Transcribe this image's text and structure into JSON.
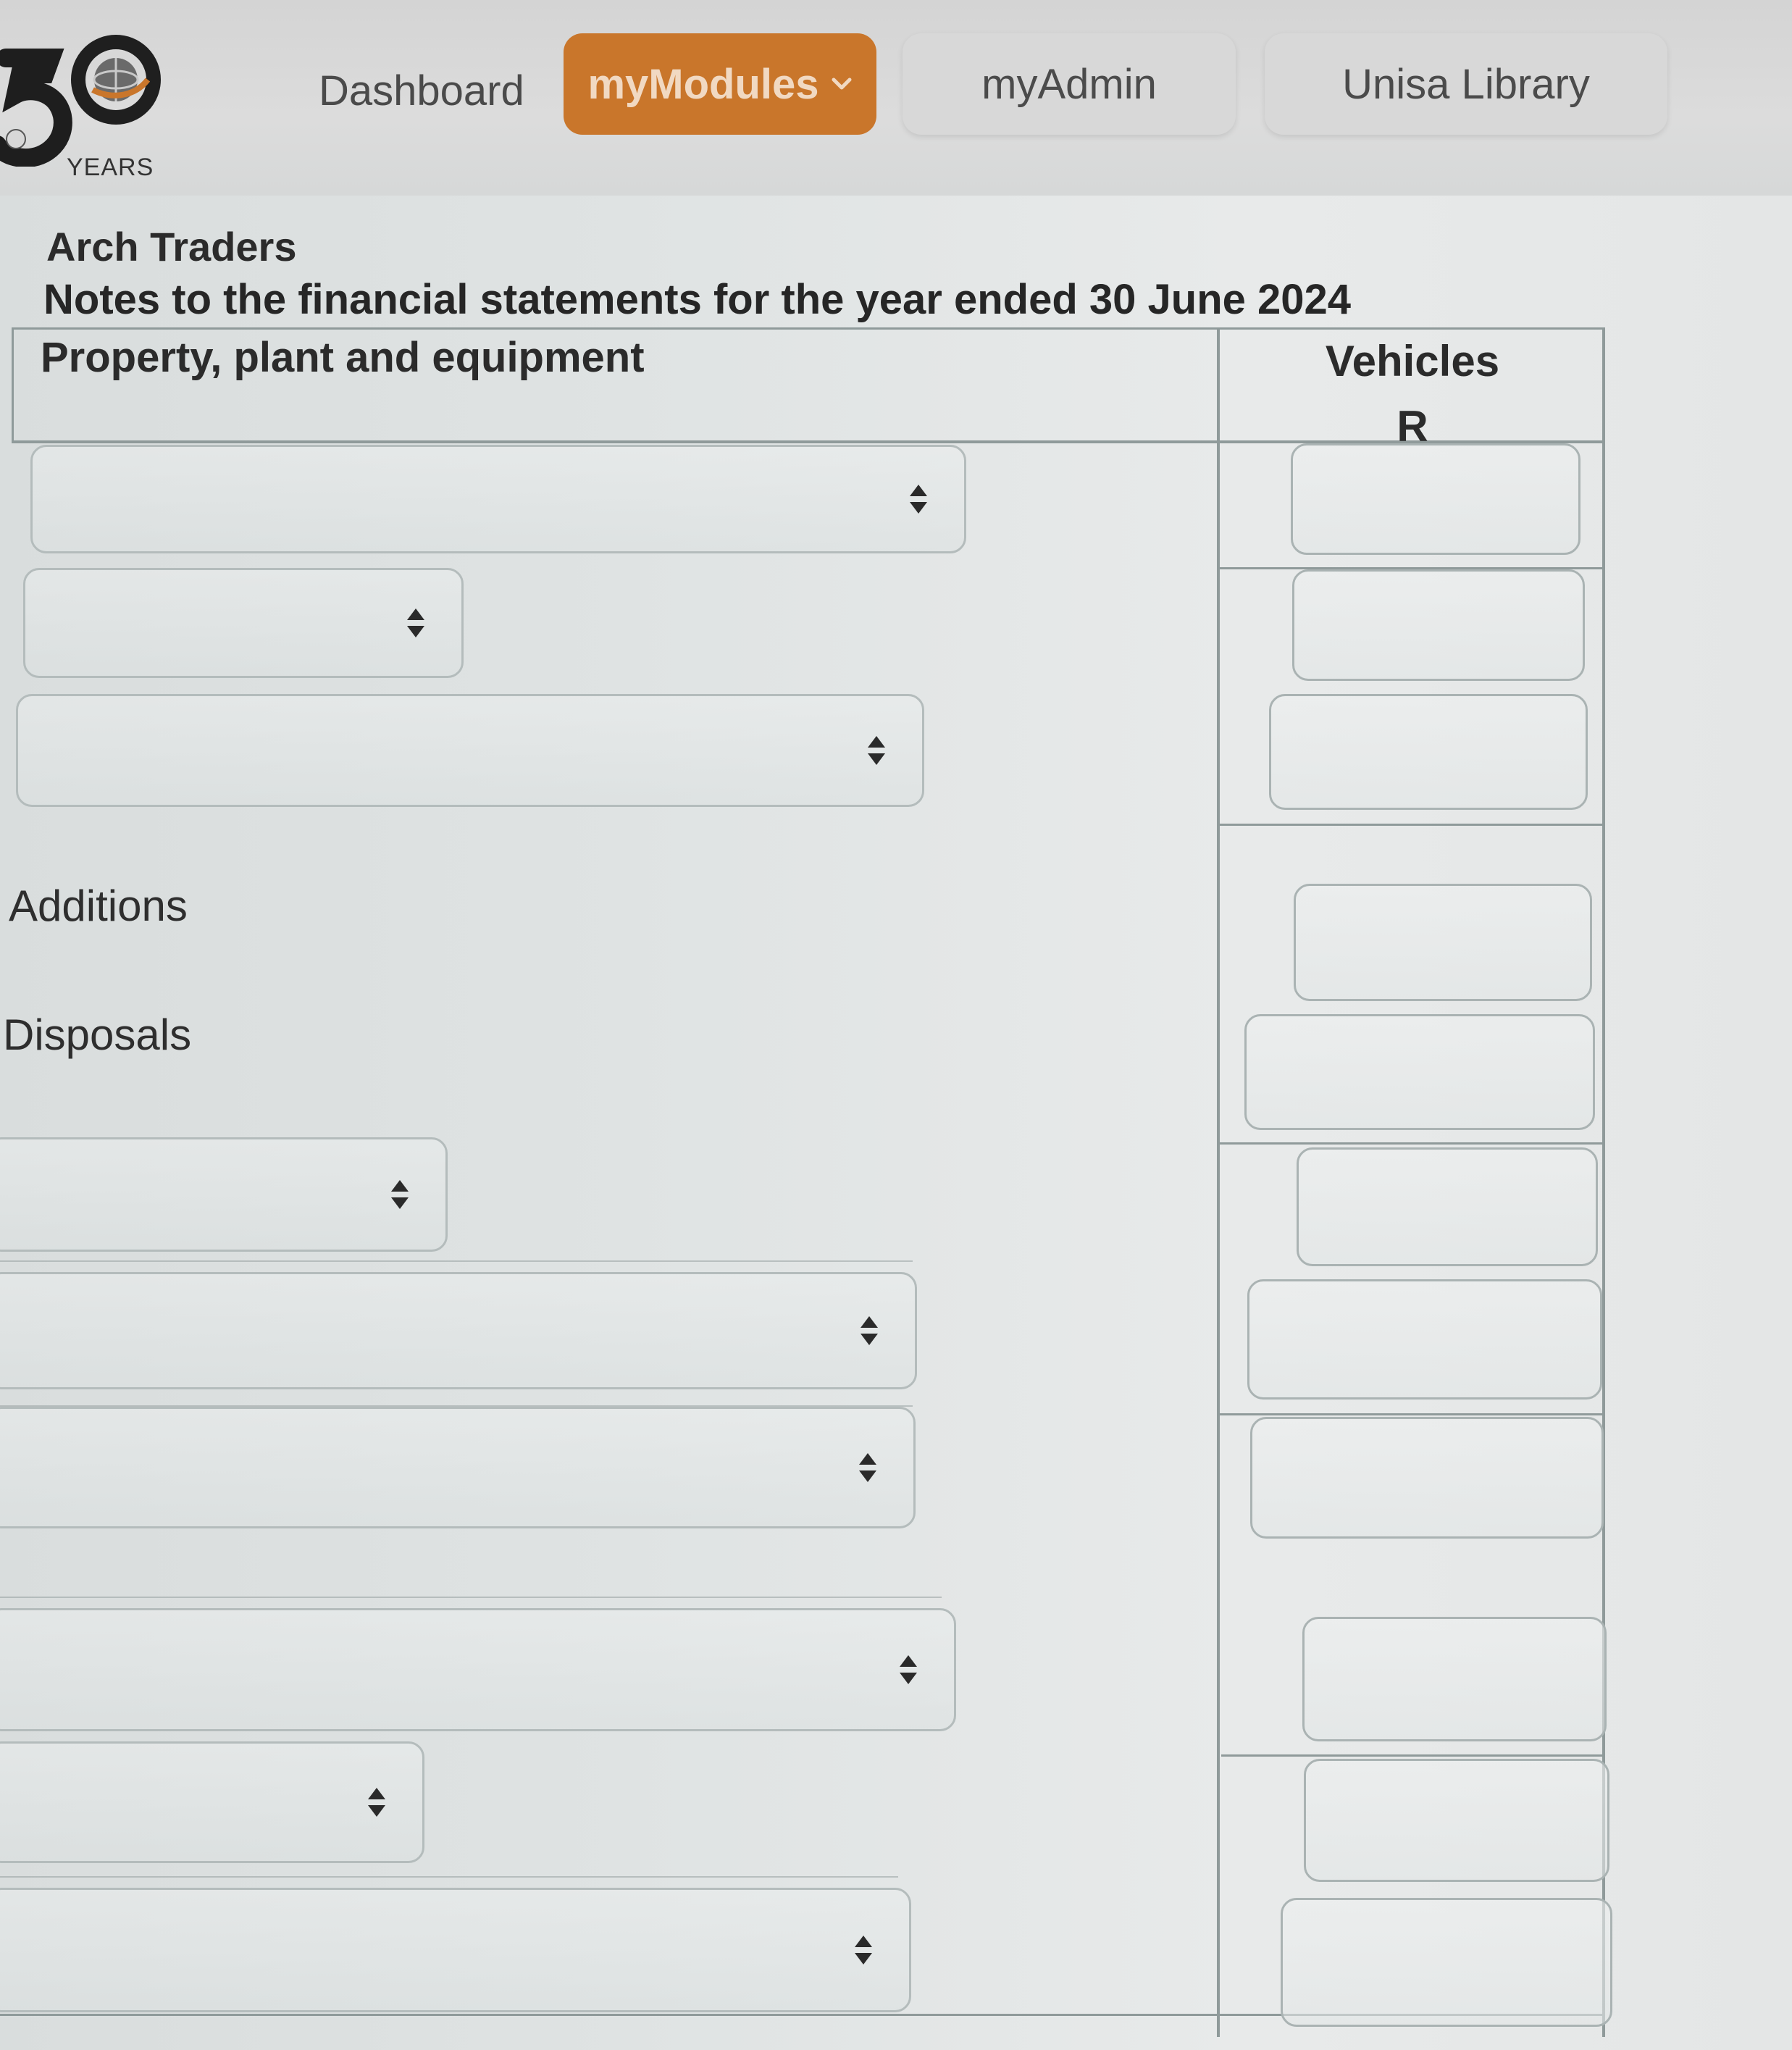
{
  "logo": {
    "years_text": "YEARS"
  },
  "nav": {
    "dashboard": "Dashboard",
    "mymodules": "myModules",
    "myadmin": "myAdmin",
    "library": "Unisa Library"
  },
  "document": {
    "company": "Arch Traders",
    "subtitle": "Notes to the financial statements for the year ended 30 June 2024"
  },
  "table": {
    "header_label": "Property, plant and equipment",
    "column_title": "Vehicles",
    "column_unit": "R",
    "labels": {
      "additions": "Additions",
      "disposals": "Disposals"
    }
  },
  "icons": {
    "dropdown": "chevron-down-icon",
    "select_arrows": "sort-arrows-icon"
  },
  "colors": {
    "accent": "#c9762b",
    "accent_text": "#f1d9c2"
  }
}
